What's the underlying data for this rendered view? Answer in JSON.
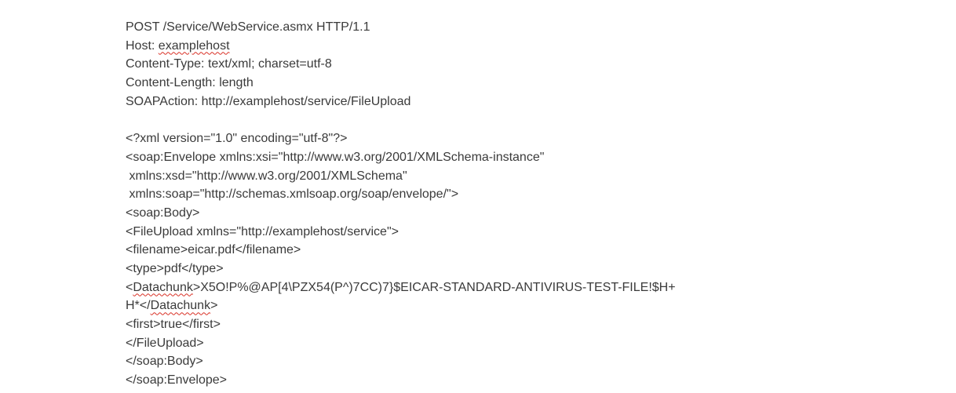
{
  "document": {
    "lines": [
      {
        "segments": [
          {
            "text": "POST /Service/WebService.asmx HTTP/1.1"
          }
        ]
      },
      {
        "segments": [
          {
            "text": "Host: "
          },
          {
            "text": "examplehost",
            "spellcheck": true
          }
        ]
      },
      {
        "segments": [
          {
            "text": "Content-Type: text/xml; charset=utf-8"
          }
        ]
      },
      {
        "segments": [
          {
            "text": "Content-Length: length"
          }
        ]
      },
      {
        "segments": [
          {
            "text": "SOAPAction: http://examplehost/service/FileUpload"
          }
        ]
      },
      {
        "segments": [
          {
            "text": ""
          }
        ]
      },
      {
        "segments": [
          {
            "text": "<?xml version=\"1.0\" encoding=\"utf-8\"?>"
          }
        ]
      },
      {
        "segments": [
          {
            "text": "<soap:Envelope xmlns:xsi=\"http://www.w3.org/2001/XMLSchema-instance\""
          }
        ]
      },
      {
        "segments": [
          {
            "text": " xmlns:xsd=\"http://www.w3.org/2001/XMLSchema\""
          }
        ]
      },
      {
        "segments": [
          {
            "text": " xmlns:soap=\"http://schemas.xmlsoap.org/soap/envelope/\">"
          }
        ]
      },
      {
        "segments": [
          {
            "text": "<soap:Body>"
          }
        ]
      },
      {
        "segments": [
          {
            "text": "<FileUpload xmlns=\"http://examplehost/service\">"
          }
        ]
      },
      {
        "segments": [
          {
            "text": "<filename>eicar.pdf</filename>"
          }
        ]
      },
      {
        "segments": [
          {
            "text": "<type>pdf</type>"
          }
        ]
      },
      {
        "segments": [
          {
            "text": "<"
          },
          {
            "text": "Datachunk",
            "spellcheck": true
          },
          {
            "text": ">X5O!P%@AP[4\\PZX54(P^)7CC)7}$EICAR-STANDARD-ANTIVIRUS-TEST-FILE!$H+"
          }
        ]
      },
      {
        "segments": [
          {
            "text": "H*</"
          },
          {
            "text": "Datachunk",
            "spellcheck": true
          },
          {
            "text": ">"
          }
        ]
      },
      {
        "segments": [
          {
            "text": "<first>true</first>"
          }
        ]
      },
      {
        "segments": [
          {
            "text": "</FileUpload>"
          }
        ]
      },
      {
        "segments": [
          {
            "text": "</soap:Body>"
          }
        ]
      },
      {
        "segments": [
          {
            "text": "</soap:Envelope>"
          }
        ]
      }
    ]
  },
  "colors": {
    "text": "#3a3a3a",
    "spellcheck_underline": "#d93025",
    "background": "#ffffff"
  }
}
